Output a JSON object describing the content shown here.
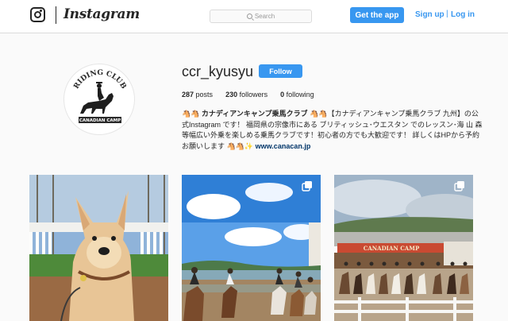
{
  "header": {
    "wordmark": "Instagram",
    "search_placeholder": "Search",
    "get_app_label": "Get the app",
    "signup_label": "Sign up",
    "separator": "|",
    "login_label": "Log in"
  },
  "profile": {
    "username": "ccr_kyusyu",
    "follow_label": "Follow",
    "posts_count": "287",
    "posts_label": "posts",
    "followers_count": "230",
    "followers_label": "followers",
    "following_count": "0",
    "following_label": "following",
    "avatar_text_top": "RIDING CLUB",
    "avatar_text_bottom": "CANADIAN CAMP",
    "bio_name": "🐴🐴 カナディアンキャンプ乗馬クラブ 🐴🐴",
    "bio_text": "【カナディアンキャンプ乗馬クラブ 九州】の公式Instagram です！ 福岡県の宗像市にある ブリティッシュ･ウエスタン でのレッスン･海 山 森等幅広い外乗を楽しめる乗馬クラブです！初心者の方でも大歓迎です！ 詳しくはHPから予約お願いします 🐴🐴✨",
    "bio_link": "www.canacan.jp"
  },
  "posts": [
    {
      "type": "single",
      "subject": "dog"
    },
    {
      "type": "carousel",
      "subject": "beach horseback riding"
    },
    {
      "type": "carousel",
      "subject": "riders at ranch arena",
      "sign_text": "CANADIAN CAMP"
    }
  ],
  "colors": {
    "accent": "#3897f0",
    "link": "#003569",
    "background": "#fafafa",
    "border": "#dbdbdb"
  }
}
